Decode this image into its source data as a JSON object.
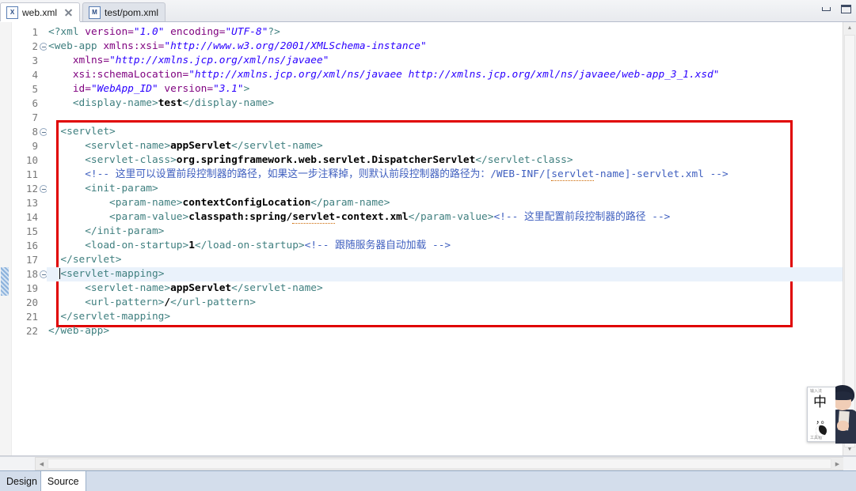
{
  "window": {
    "minimize_label": "minimize",
    "maximize_label": "maximize"
  },
  "tabs": [
    {
      "icon": "X",
      "label": "web.xml",
      "active": true,
      "closable": true
    },
    {
      "icon": "M",
      "label": "test/pom.xml",
      "active": false,
      "closable": false
    }
  ],
  "editor": {
    "current_line": 18,
    "fold_lines": [
      2,
      8,
      12,
      18
    ],
    "changed_lines": [
      18,
      19
    ],
    "lines": [
      {
        "n": 1,
        "tokens": [
          {
            "c": "t-pi",
            "t": "<?xml "
          },
          {
            "c": "t-attr",
            "t": "version="
          },
          {
            "c": "t-val",
            "t": "\"1.0\""
          },
          {
            "c": "t-pi",
            "t": " "
          },
          {
            "c": "t-attr",
            "t": "encoding="
          },
          {
            "c": "t-val",
            "t": "\"UTF-8\""
          },
          {
            "c": "t-pi",
            "t": "?>"
          }
        ]
      },
      {
        "n": 2,
        "tokens": [
          {
            "c": "t-tag",
            "t": "<web-app "
          },
          {
            "c": "t-attr",
            "t": "xmlns:xsi="
          },
          {
            "c": "t-val",
            "t": "\"http://www.w3.org/2001/XMLSchema-instance\""
          }
        ]
      },
      {
        "n": 3,
        "tokens": [
          {
            "c": "t-tag",
            "t": "    "
          },
          {
            "c": "t-attr",
            "t": "xmlns="
          },
          {
            "c": "t-val",
            "t": "\"http://xmlns.jcp.org/xml/ns/javaee\""
          }
        ]
      },
      {
        "n": 4,
        "tokens": [
          {
            "c": "t-tag",
            "t": "    "
          },
          {
            "c": "t-attr",
            "t": "xsi:schemaLocation="
          },
          {
            "c": "t-val",
            "t": "\"http://xmlns.jcp.org/xml/ns/javaee http://xmlns.jcp.org/xml/ns/javaee/web-app_3_1.xsd\""
          }
        ]
      },
      {
        "n": 5,
        "tokens": [
          {
            "c": "t-tag",
            "t": "    "
          },
          {
            "c": "t-attr",
            "t": "id="
          },
          {
            "c": "t-val",
            "t": "\"WebApp_ID\""
          },
          {
            "c": "t-tag",
            "t": " "
          },
          {
            "c": "t-attr",
            "t": "version="
          },
          {
            "c": "t-val",
            "t": "\"3.1\""
          },
          {
            "c": "t-tag",
            "t": ">"
          }
        ]
      },
      {
        "n": 6,
        "tokens": [
          {
            "c": "t-tag",
            "t": "    <display-name>"
          },
          {
            "c": "t-txt",
            "t": "test"
          },
          {
            "c": "t-tag",
            "t": "</display-name>"
          }
        ]
      },
      {
        "n": 7,
        "tokens": []
      },
      {
        "n": 8,
        "tokens": [
          {
            "c": "t-tag",
            "t": "  <servlet>"
          }
        ]
      },
      {
        "n": 9,
        "tokens": [
          {
            "c": "t-tag",
            "t": "      <servlet-name>"
          },
          {
            "c": "t-txt",
            "t": "appServlet"
          },
          {
            "c": "t-tag",
            "t": "</servlet-name>"
          }
        ]
      },
      {
        "n": 10,
        "tokens": [
          {
            "c": "t-tag",
            "t": "      <servlet-class>"
          },
          {
            "c": "t-txt",
            "t": "org.springframework.web.servlet.DispatcherServlet"
          },
          {
            "c": "t-tag",
            "t": "</servlet-class>"
          }
        ]
      },
      {
        "n": 11,
        "tokens": [
          {
            "c": "t-cmt",
            "t": "      <!-- 这里可以设置前段控制器的路径，如果这一步注释掉，则默认前段控制器的路径为：/WEB-INF/["
          },
          {
            "c": "t-cmt sp-err",
            "t": "servlet"
          },
          {
            "c": "t-cmt",
            "t": "-name]-servlet.xml -->"
          }
        ]
      },
      {
        "n": 12,
        "tokens": [
          {
            "c": "t-tag",
            "t": "      <init-param>"
          }
        ]
      },
      {
        "n": 13,
        "tokens": [
          {
            "c": "t-tag",
            "t": "          <param-name>"
          },
          {
            "c": "t-txt",
            "t": "contextConfigLocation"
          },
          {
            "c": "t-tag",
            "t": "</param-name>"
          }
        ]
      },
      {
        "n": 14,
        "tokens": [
          {
            "c": "t-tag",
            "t": "          <param-value>"
          },
          {
            "c": "t-txt",
            "t": "classpath:spring/"
          },
          {
            "c": "t-txt sp-err",
            "t": "servlet"
          },
          {
            "c": "t-txt",
            "t": "-context.xml"
          },
          {
            "c": "t-tag",
            "t": "</param-value>"
          },
          {
            "c": "t-cmt",
            "t": "<!-- 这里配置前段控制器的路径 -->"
          }
        ]
      },
      {
        "n": 15,
        "tokens": [
          {
            "c": "t-tag",
            "t": "      </init-param>"
          }
        ]
      },
      {
        "n": 16,
        "tokens": [
          {
            "c": "t-tag",
            "t": "      <load-on-startup>"
          },
          {
            "c": "t-txt",
            "t": "1"
          },
          {
            "c": "t-tag",
            "t": "</load-on-startup>"
          },
          {
            "c": "t-cmt",
            "t": "<!-- 跟随服务器自动加载 -->"
          }
        ]
      },
      {
        "n": 17,
        "tokens": [
          {
            "c": "t-tag",
            "t": "  </servlet>"
          }
        ]
      },
      {
        "n": 18,
        "tokens": [
          {
            "c": "t-tag",
            "t": "  <servlet-mapping>"
          }
        ]
      },
      {
        "n": 19,
        "tokens": [
          {
            "c": "t-tag",
            "t": "      <servlet-name>"
          },
          {
            "c": "t-txt",
            "t": "appServlet"
          },
          {
            "c": "t-tag",
            "t": "</servlet-name>"
          }
        ]
      },
      {
        "n": 20,
        "tokens": [
          {
            "c": "t-tag",
            "t": "      <url-pattern>"
          },
          {
            "c": "t-txt",
            "t": "/"
          },
          {
            "c": "t-tag",
            "t": "</url-pattern>"
          }
        ]
      },
      {
        "n": 21,
        "tokens": [
          {
            "c": "t-tag",
            "t": "  </servlet-mapping>"
          }
        ]
      },
      {
        "n": 22,
        "tokens": [
          {
            "c": "t-tag",
            "t": "</web-app>"
          }
        ]
      }
    ]
  },
  "annotation": {
    "color": "#e00000",
    "covers_lines": "8-21"
  },
  "scrollbars": {
    "vertical_up": "▲",
    "vertical_down": "▼",
    "horizontal_left": "◀",
    "horizontal_right": "▶"
  },
  "bottom_tabs": [
    {
      "label": "Design",
      "active": false
    },
    {
      "label": "Source",
      "active": true
    }
  ],
  "ime": {
    "mode_label": "中",
    "punct_label": "，。",
    "deco_top": "输入法",
    "deco_bottom": "工具箱"
  }
}
